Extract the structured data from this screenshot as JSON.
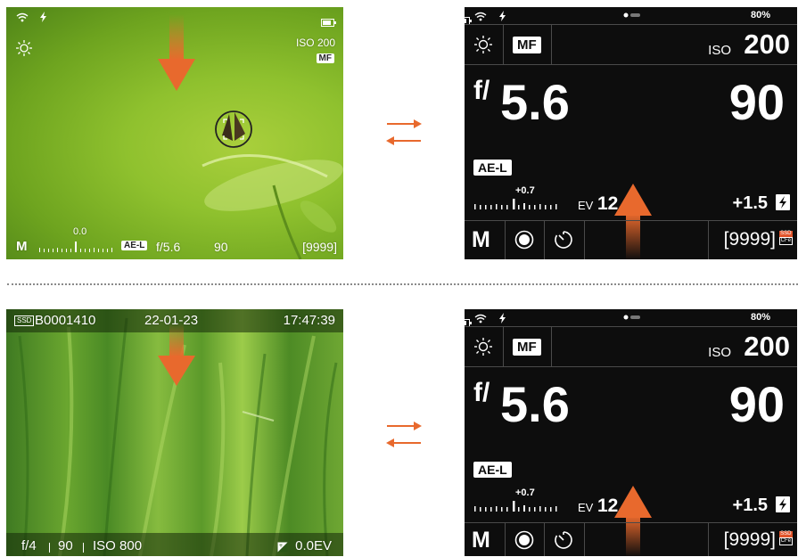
{
  "panel1": {
    "iso_label": "ISO 200",
    "focus_mode": "MF",
    "ev_value": "0.0",
    "mode": "M",
    "ael": "AE-L",
    "aperture": "f/5.6",
    "shutter": "90",
    "shots": "[9999]"
  },
  "panel2": {
    "card": "SSD",
    "filename": "B0001410",
    "date": "22-01-23",
    "time": "17:47:39",
    "aperture": "f/4",
    "shutter": "90",
    "iso": "ISO 800",
    "ev": "0.0EV"
  },
  "top_screen": {
    "battery": "80%",
    "focus_mode": "MF",
    "iso_label": "ISO",
    "iso_value": "200",
    "aperture_prefix": "f/",
    "aperture_value": "5.6",
    "shutter": "90",
    "ael": "AE-L",
    "ev_comp": "+0.7",
    "ev_label": "EV",
    "ev_value": "12.0",
    "flash_comp": "+1.5",
    "mode": "M",
    "shots": "[9999]",
    "card_top": "SSD",
    "card_bottom": "CFe"
  },
  "colors": {
    "accent": "#e8692d",
    "screen_bg": "#0d0d0d",
    "divider": "#4a4a4a"
  },
  "icons": [
    "wifi-icon",
    "flash-icon",
    "battery-icon",
    "brightness-icon",
    "drive-single-icon",
    "self-timer-icon",
    "flash-bolt-icon",
    "page-dots-icon",
    "ev-icon",
    "down-arrow-icon",
    "up-arrow-icon",
    "swap-arrows-icon"
  ]
}
